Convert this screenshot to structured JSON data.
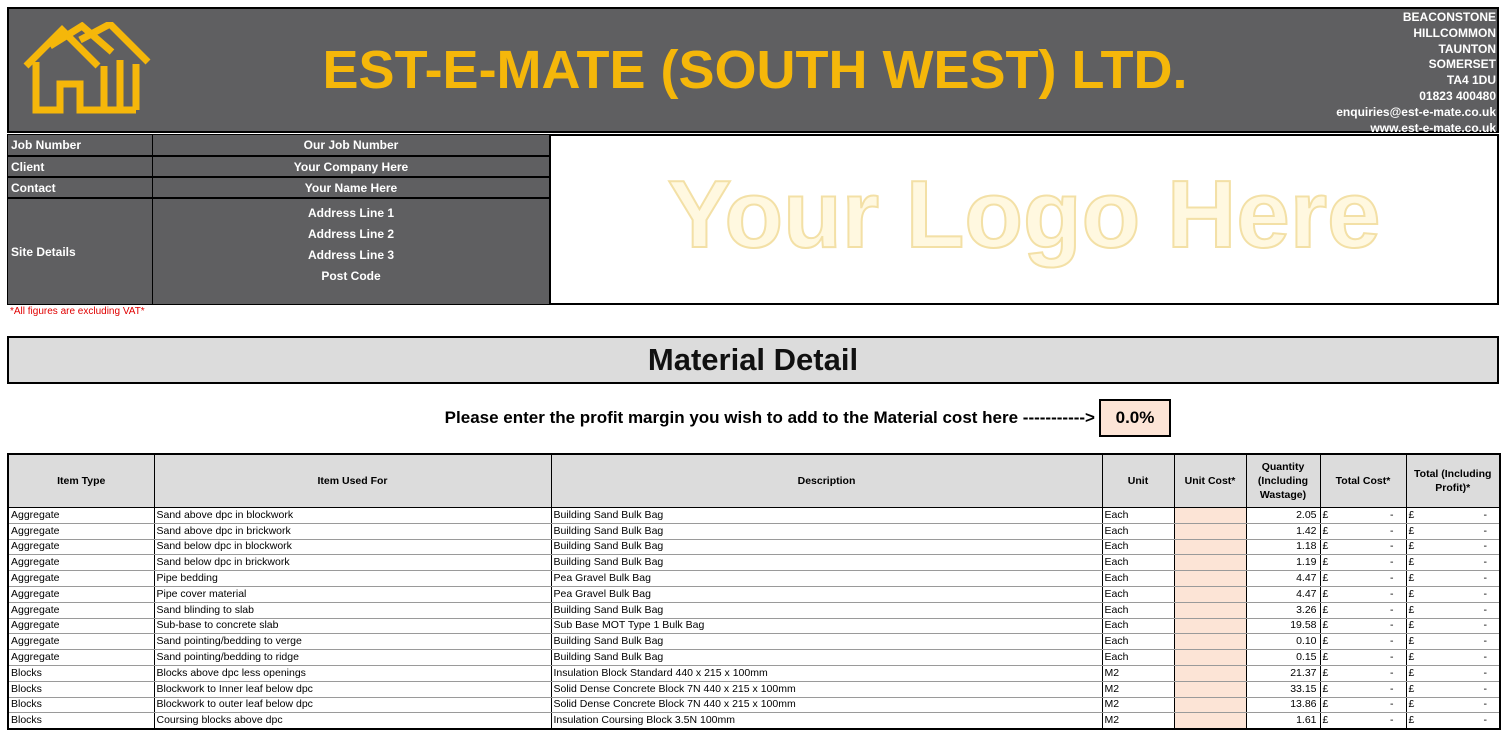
{
  "header": {
    "company": "EST-E-MATE (SOUTH WEST) LTD.",
    "address_lines": [
      "BEACONSTONE",
      "HILLCOMMON",
      "TAUNTON",
      "SOMERSET",
      "TA4 1DU",
      "01823 400480",
      "enquiries@est-e-mate.co.uk",
      "www.est-e-mate.co.uk"
    ],
    "logo_color": "#f5b70a"
  },
  "job": {
    "job_number_label": "Job Number",
    "job_number_value": "Our Job Number",
    "client_label": "Client",
    "client_value": "Your Company Here",
    "contact_label": "Contact",
    "contact_value": "Your Name Here",
    "site_label": "Site Details",
    "site_lines": [
      "Address Line 1",
      "Address Line 2",
      "Address Line 3",
      "Post Code"
    ]
  },
  "logo_placeholder": "Your Logo Here",
  "vat_note": "*All figures are excluding VAT*",
  "section_title": "Material Detail",
  "margin": {
    "prompt": "Please enter the profit margin you wish to add to the Material cost here ----------->",
    "value": "0.0%"
  },
  "table": {
    "headers": {
      "item_type": "Item Type",
      "item_used_for": "Item Used For",
      "description": "Description",
      "unit": "Unit",
      "unit_cost": "Unit Cost*",
      "quantity": "Quantity (Including Wastage)",
      "total_cost": "Total Cost*",
      "total_profit": "Total (Including Profit)*"
    },
    "currency": "£",
    "dash": "-",
    "rows": [
      {
        "type": "Aggregate",
        "used_for": "Sand above dpc in blockwork",
        "description": "Building Sand Bulk Bag",
        "unit": "Each",
        "qty": "2.05"
      },
      {
        "type": "Aggregate",
        "used_for": "Sand above dpc in brickwork",
        "description": "Building Sand Bulk Bag",
        "unit": "Each",
        "qty": "1.42"
      },
      {
        "type": "Aggregate",
        "used_for": "Sand below dpc in blockwork",
        "description": "Building Sand Bulk Bag",
        "unit": "Each",
        "qty": "1.18"
      },
      {
        "type": "Aggregate",
        "used_for": "Sand below dpc in brickwork",
        "description": "Building Sand Bulk Bag",
        "unit": "Each",
        "qty": "1.19"
      },
      {
        "type": "Aggregate",
        "used_for": "Pipe bedding",
        "description": "Pea Gravel Bulk Bag",
        "unit": "Each",
        "qty": "4.47"
      },
      {
        "type": "Aggregate",
        "used_for": "Pipe cover material",
        "description": "Pea Gravel Bulk Bag",
        "unit": "Each",
        "qty": "4.47"
      },
      {
        "type": "Aggregate",
        "used_for": "Sand blinding to slab",
        "description": "Building Sand Bulk Bag",
        "unit": "Each",
        "qty": "3.26"
      },
      {
        "type": "Aggregate",
        "used_for": "Sub-base to concrete slab",
        "description": "Sub Base MOT Type 1 Bulk Bag",
        "unit": "Each",
        "qty": "19.58"
      },
      {
        "type": "Aggregate",
        "used_for": "Sand pointing/bedding to verge",
        "description": "Building Sand Bulk Bag",
        "unit": "Each",
        "qty": "0.10"
      },
      {
        "type": "Aggregate",
        "used_for": "Sand pointing/bedding to ridge",
        "description": "Building Sand Bulk Bag",
        "unit": "Each",
        "qty": "0.15"
      },
      {
        "type": "Blocks",
        "used_for": "Blocks above dpc less openings",
        "description": "Insulation Block Standard 440 x 215 x 100mm",
        "unit": "M2",
        "qty": "21.37"
      },
      {
        "type": "Blocks",
        "used_for": "Blockwork to Inner leaf below dpc",
        "description": "Solid Dense Concrete Block 7N 440 x 215 x 100mm",
        "unit": "M2",
        "qty": "33.15"
      },
      {
        "type": "Blocks",
        "used_for": "Blockwork to outer leaf below dpc",
        "description": "Solid Dense Concrete Block 7N 440 x 215 x 100mm",
        "unit": "M2",
        "qty": "13.86"
      },
      {
        "type": "Blocks",
        "used_for": "Coursing blocks above dpc",
        "description": "Insulation Coursing Block 3.5N 100mm",
        "unit": "M2",
        "qty": "1.61"
      }
    ]
  }
}
